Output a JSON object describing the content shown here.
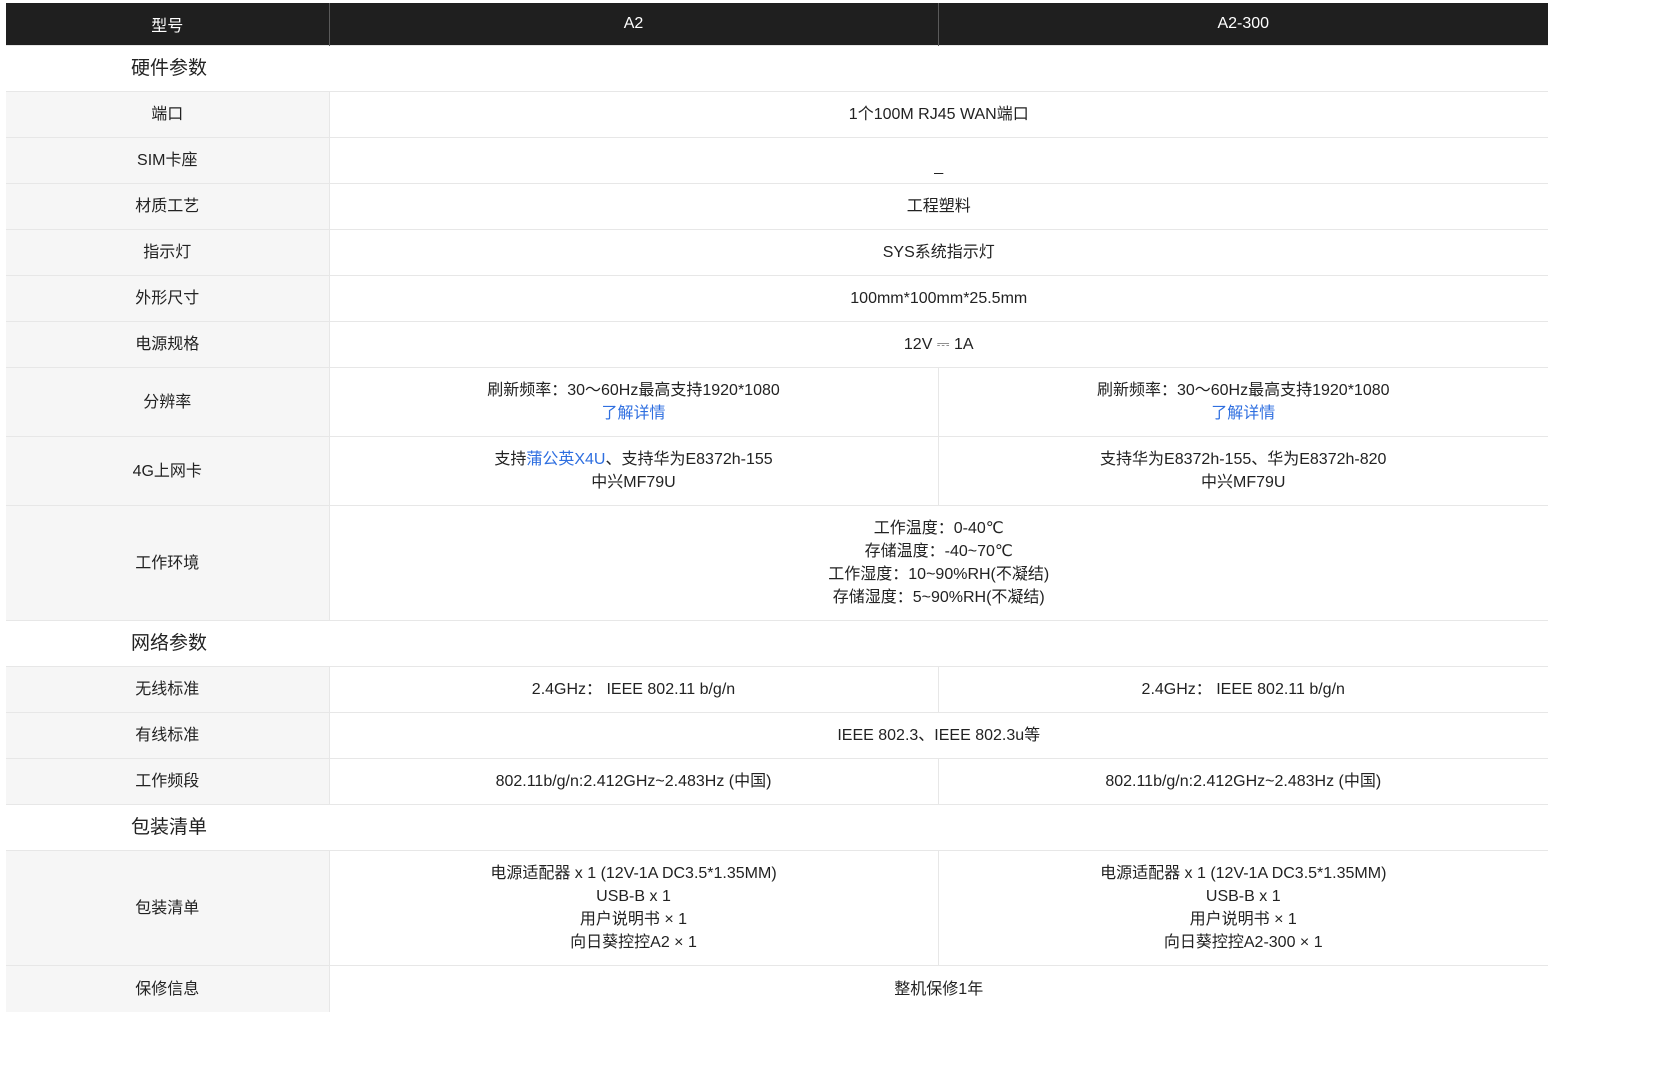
{
  "header": {
    "label": "型号",
    "col_a2": "A2",
    "col_a2_300": "A2-300"
  },
  "sections": {
    "hardware": "硬件参数",
    "network": "网络参数",
    "package": "包装清单"
  },
  "rows": {
    "port": {
      "label": "端口",
      "value": "1个100M RJ45 WAN端口"
    },
    "sim": {
      "label": "SIM卡座",
      "value": "_"
    },
    "material": {
      "label": "材质工艺",
      "value": "工程塑料"
    },
    "indicator": {
      "label": "指示灯",
      "value": "SYS系统指示灯"
    },
    "size": {
      "label": "外形尺寸",
      "value": "100mm*100mm*25.5mm"
    },
    "power": {
      "label": "电源规格",
      "value": "12V ⎓ 1A"
    },
    "resolution": {
      "label": "分辨率",
      "a2": {
        "text": "刷新频率：30～60Hz最高支持1920*1080",
        "link": "了解详情"
      },
      "a2_300": {
        "text": "刷新频率：30～60Hz最高支持1920*1080",
        "link": "了解详情"
      }
    },
    "card4g": {
      "label": "4G上网卡",
      "a2": {
        "prefix": "支持",
        "link": "蒲公英X4U",
        "suffix": "、支持华为E8372h-155",
        "line2": "中兴MF79U"
      },
      "a2_300": {
        "line1": "支持华为E8372h-155、华为E8372h-820",
        "line2": "中兴MF79U"
      }
    },
    "environment": {
      "label": "工作环境",
      "lines": [
        "工作温度：0-40℃",
        "存储温度：-40~70℃",
        "工作湿度：10~90%RH(不凝结)",
        "存储湿度：5~90%RH(不凝结)"
      ]
    },
    "wireless": {
      "label": "无线标准",
      "a2": "2.4GHz： IEEE 802.11 b/g/n",
      "a2_300": "2.4GHz： IEEE 802.11 b/g/n"
    },
    "wired": {
      "label": "有线标准",
      "value": "IEEE 802.3、IEEE 802.3u等"
    },
    "band": {
      "label": "工作频段",
      "a2": "802.11b/g/n:2.412GHz~2.483Hz (中国)",
      "a2_300": "802.11b/g/n:2.412GHz~2.483Hz (中国)"
    },
    "packlist": {
      "label": "包装清单",
      "a2": [
        "电源适配器 x 1 (12V-1A DC3.5*1.35MM)",
        "USB-B x 1",
        "用户说明书 × 1",
        "向日葵控控A2 × 1"
      ],
      "a2_300": [
        "电源适配器 x 1 (12V-1A DC3.5*1.35MM)",
        "USB-B x 1",
        "用户说明书 × 1",
        "向日葵控控A2-300 × 1"
      ]
    },
    "warranty": {
      "label": "保修信息",
      "value": "整机保修1年"
    }
  }
}
